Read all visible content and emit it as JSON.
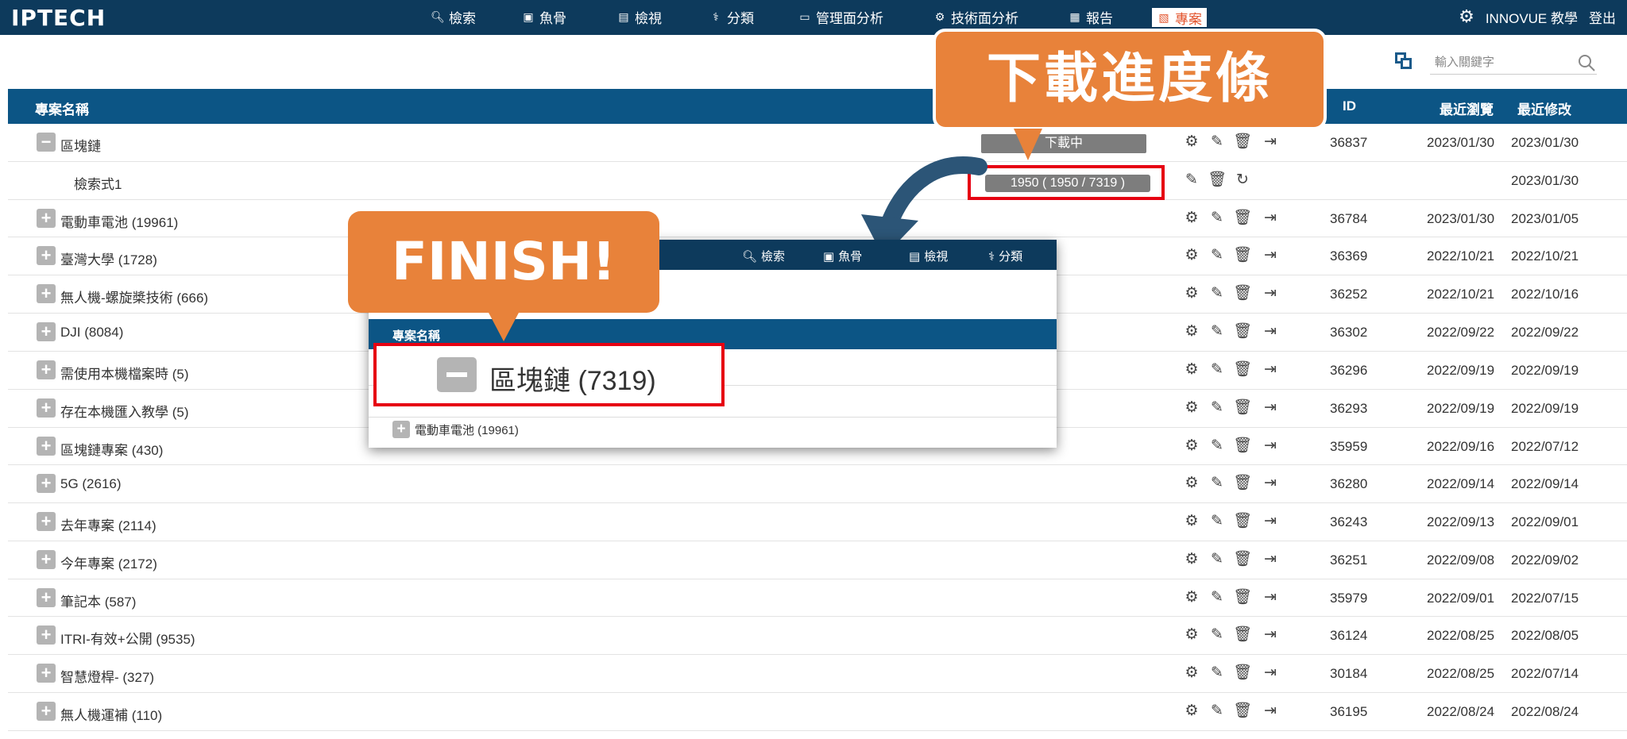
{
  "nav": {
    "logo": "IPTECH",
    "items": [
      {
        "label": "檢索",
        "icon": "magnifier-icon"
      },
      {
        "label": "魚骨",
        "icon": "fishbone-icon"
      },
      {
        "label": "檢視",
        "icon": "list-view-icon"
      },
      {
        "label": "分類",
        "icon": "classify-icon"
      },
      {
        "label": "管理面分析",
        "icon": "monitor-chart-icon"
      },
      {
        "label": "技術面分析",
        "icon": "gears-icon"
      },
      {
        "label": "報告",
        "icon": "report-icon"
      },
      {
        "label": "專案",
        "icon": "project-icon",
        "active": true
      }
    ],
    "user": "INNOVUE 教學",
    "logout": "登出"
  },
  "search": {
    "placeholder": "輸入關鍵字"
  },
  "table": {
    "headers": {
      "name": "專案名稱",
      "id": "ID",
      "viewed": "最近瀏覽",
      "modified": "最近修改"
    },
    "rows": [
      {
        "name": "區塊鏈",
        "toggle": "minus",
        "id": "36837",
        "viewed": "2023/01/30",
        "modified": "2023/01/30",
        "status": "下載中"
      },
      {
        "name": "檢索式1",
        "child": true,
        "id": "",
        "viewed": "",
        "modified": "2023/01/30",
        "progress": "1950 ( 1950 / 7319 )",
        "progress_fraction": 0.2664
      },
      {
        "name": "電動車電池 (19961)",
        "toggle": "plus",
        "id": "36784",
        "viewed": "2023/01/30",
        "modified": "2023/01/05"
      },
      {
        "name": "臺灣大學 (1728)",
        "toggle": "plus",
        "id": "36369",
        "viewed": "2022/10/21",
        "modified": "2022/10/21"
      },
      {
        "name": "無人機-螺旋槳技術 (666)",
        "toggle": "plus",
        "id": "36252",
        "viewed": "2022/10/21",
        "modified": "2022/10/16"
      },
      {
        "name": "DJI (8084)",
        "toggle": "plus",
        "id": "36302",
        "viewed": "2022/09/22",
        "modified": "2022/09/22"
      },
      {
        "name": "需使用本機檔案時 (5)",
        "toggle": "plus",
        "id": "36296",
        "viewed": "2022/09/19",
        "modified": "2022/09/19"
      },
      {
        "name": "存在本機匯入教學 (5)",
        "toggle": "plus",
        "id": "36293",
        "viewed": "2022/09/19",
        "modified": "2022/09/19"
      },
      {
        "name": "區塊鏈專案 (430)",
        "toggle": "plus",
        "id": "35959",
        "viewed": "2022/09/16",
        "modified": "2022/07/12"
      },
      {
        "name": "5G (2616)",
        "toggle": "plus",
        "id": "36280",
        "viewed": "2022/09/14",
        "modified": "2022/09/14"
      },
      {
        "name": "去年專案 (2114)",
        "toggle": "plus",
        "id": "36243",
        "viewed": "2022/09/13",
        "modified": "2022/09/01"
      },
      {
        "name": "今年專案 (2172)",
        "toggle": "plus",
        "id": "36251",
        "viewed": "2022/09/08",
        "modified": "2022/09/02"
      },
      {
        "name": "筆記本 (587)",
        "toggle": "plus",
        "id": "35979",
        "viewed": "2022/09/01",
        "modified": "2022/07/15"
      },
      {
        "name": "ITRI-有效+公開 (9535)",
        "toggle": "plus",
        "id": "36124",
        "viewed": "2022/08/25",
        "modified": "2022/08/05"
      },
      {
        "name": "智慧燈桿- (327)",
        "toggle": "plus",
        "id": "30184",
        "viewed": "2022/08/25",
        "modified": "2022/07/14"
      },
      {
        "name": "無人機運補 (110)",
        "toggle": "plus",
        "id": "36195",
        "viewed": "2022/08/24",
        "modified": "2022/08/24"
      }
    ]
  },
  "callouts": {
    "download": "下載進度條",
    "finish": "FINISH!"
  },
  "inset": {
    "nav_items": [
      "檢索",
      "魚骨",
      "檢視",
      "分類"
    ],
    "header": "專案名稱",
    "finished_name": "區塊鏈 (7319)",
    "next_row": "電動車電池 (19961)"
  },
  "colors": {
    "nav_bg": "#0d3a5c",
    "header_bg": "#0c5585",
    "callout": "#e8823a",
    "highlight": "#e60012",
    "active_tab": "#e3562f"
  }
}
